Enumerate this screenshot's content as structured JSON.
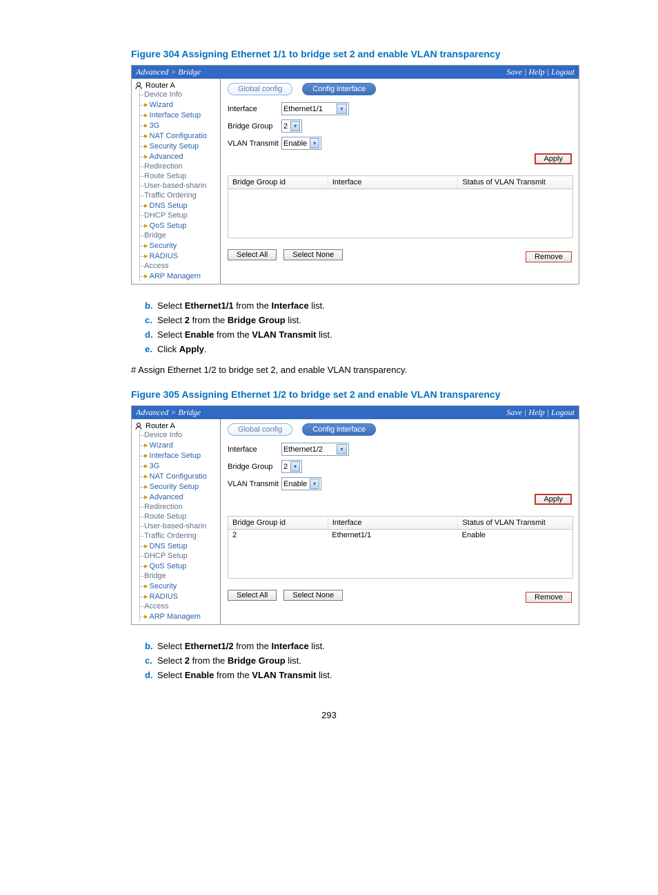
{
  "figure1": {
    "title": "Figure 304 Assigning Ethernet 1/1 to bridge set 2 and enable VLAN transparency",
    "breadcrumb": "Advanced > Bridge",
    "header_links": "Save | Help | Logout",
    "root": "Router A",
    "tree": [
      "Device Info",
      "Wizard",
      "Interface Setup",
      "3G",
      "NAT Configuratio",
      "Security Setup",
      "Advanced",
      "Redirection",
      "Route Setup",
      "User-based-sharin",
      "Traffic Ordering",
      "DNS Setup",
      "DHCP Setup",
      "QoS Setup",
      "Bridge",
      "Security",
      "RADIUS",
      "Access",
      "ARP Managem"
    ],
    "tabs": {
      "global": "Global config",
      "config": "Config interface"
    },
    "form": {
      "interface_label": "Interface",
      "interface_value": "Ethernet1/1",
      "bridge_group_label": "Bridge Group",
      "bridge_group_value": "2",
      "vlan_transmit_label": "VLAN Transmit",
      "vlan_transmit_value": "Enable"
    },
    "apply": "Apply",
    "grid": {
      "bridge_id": "Bridge Group id",
      "interface": "Interface",
      "status": "Status of VLAN Transmit"
    },
    "select_all": "Select All",
    "select_none": "Select None",
    "remove": "Remove"
  },
  "steps1": {
    "b": {
      "pre": "Select ",
      "strong1": "Ethernet1/1",
      "mid": " from the ",
      "strong2": "Interface",
      "post": " list."
    },
    "c": {
      "pre": "Select ",
      "strong1": "2",
      "mid": " from the ",
      "strong2": "Bridge Group",
      "post": " list."
    },
    "d": {
      "pre": "Select ",
      "strong1": "Enable",
      "mid": " from the ",
      "strong2": "VLAN Transmit",
      "post": " list."
    },
    "e": {
      "pre": "Click ",
      "strong1": "Apply",
      "post": "."
    }
  },
  "between_text": "# Assign Ethernet 1/2 to bridge set 2, and enable VLAN transparency.",
  "figure2": {
    "title": "Figure 305 Assigning Ethernet 1/2 to bridge set 2 and enable VLAN transparency",
    "breadcrumb": "Advanced > Bridge",
    "header_links": "Save | Help | Logout",
    "root": "Router A",
    "tree": [
      "Device Info",
      "Wizard",
      "Interface Setup",
      "3G",
      "NAT Configuratio",
      "Security Setup",
      "Advanced",
      "Redirection",
      "Route Setup",
      "User-based-sharin",
      "Traffic Ordering",
      "DNS Setup",
      "DHCP Setup",
      "QoS Setup",
      "Bridge",
      "Security",
      "RADIUS",
      "Access",
      "ARP Managem"
    ],
    "tabs": {
      "global": "Global config",
      "config": "Config interface"
    },
    "form": {
      "interface_label": "Interface",
      "interface_value": "Ethernet1/2",
      "bridge_group_label": "Bridge Group",
      "bridge_group_value": "2",
      "vlan_transmit_label": "VLAN Transmit",
      "vlan_transmit_value": "Enable"
    },
    "apply": "Apply",
    "grid": {
      "bridge_id": "Bridge Group id",
      "interface": "Interface",
      "status": "Status of VLAN Transmit"
    },
    "row": {
      "id": "2",
      "iface": "Ethernet1/1",
      "status": "Enable"
    },
    "select_all": "Select All",
    "select_none": "Select None",
    "remove": "Remove"
  },
  "steps2": {
    "b": {
      "pre": "Select ",
      "strong1": "Ethernet1/2",
      "mid": " from the ",
      "strong2": "Interface",
      "post": " list."
    },
    "c": {
      "pre": "Select ",
      "strong1": "2",
      "mid": " from the ",
      "strong2": "Bridge Group",
      "post": " list."
    },
    "d": {
      "pre": "Select ",
      "strong1": "Enable",
      "mid": " from the ",
      "strong2": "VLAN Transmit",
      "post": " list."
    }
  },
  "page_number": "293"
}
